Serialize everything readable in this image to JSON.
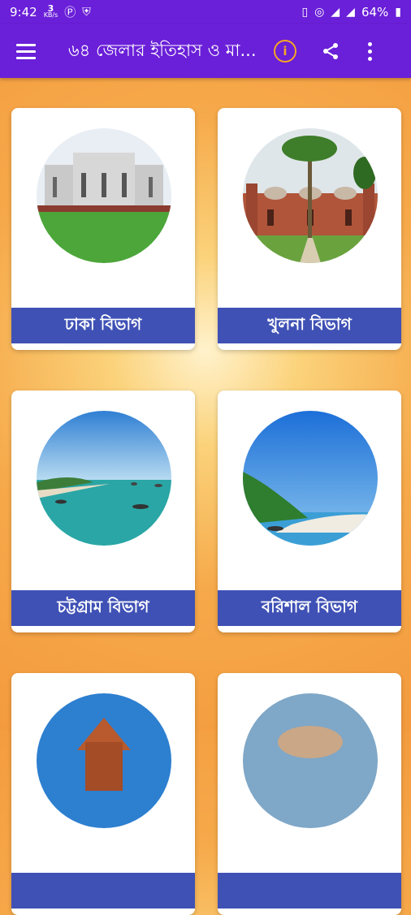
{
  "status_bar": {
    "time": "9:42",
    "speed_value": "3",
    "speed_unit": "KB/s",
    "battery": "64%"
  },
  "app_bar": {
    "title": "৬৪ জেলার ইতিহাস ও মা..."
  },
  "divisions": [
    {
      "label": "ঢাকা বিভাগ"
    },
    {
      "label": "খুলনা বিভাগ"
    },
    {
      "label": "চট্টগ্রাম বিভাগ"
    },
    {
      "label": "বরিশাল বিভাগ"
    },
    {
      "label": ""
    },
    {
      "label": ""
    }
  ],
  "colors": {
    "primary": "#6a1fd8",
    "label_bar": "#3f51b5",
    "info_icon": "#f5a623"
  }
}
